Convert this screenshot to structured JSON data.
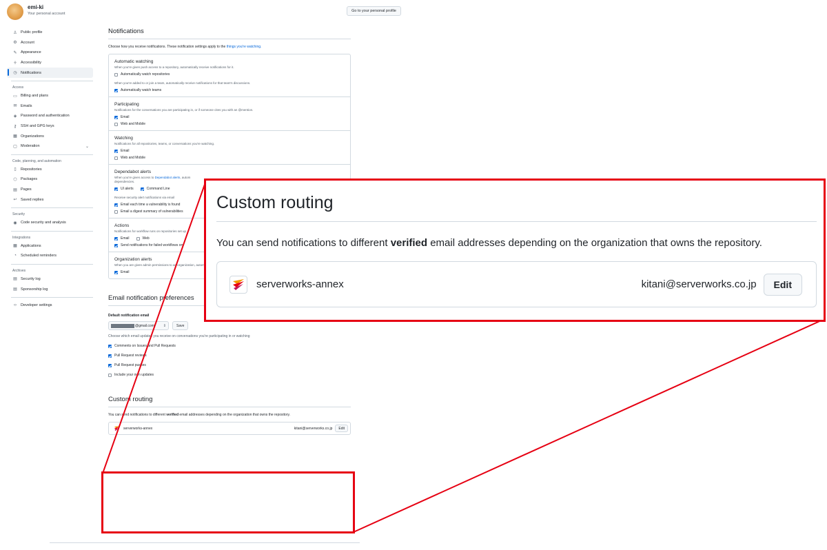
{
  "user": {
    "name": "emi-ki",
    "subtitle": "Your personal account",
    "profile_button": "Go to your personal profile"
  },
  "sidebar": {
    "items": [
      {
        "icon": "person-icon",
        "glyph": "♙",
        "label": "Public profile"
      },
      {
        "icon": "gear-icon",
        "glyph": "⚙",
        "label": "Account"
      },
      {
        "icon": "paintbrush-icon",
        "glyph": "✎",
        "label": "Appearance"
      },
      {
        "icon": "accessibility-icon",
        "glyph": "☥",
        "label": "Accessibility"
      },
      {
        "icon": "bell-icon",
        "glyph": "◷",
        "label": "Notifications",
        "active": true
      }
    ],
    "groups": [
      {
        "heading": "Access",
        "items": [
          {
            "icon": "credit-card-icon",
            "glyph": "▭",
            "label": "Billing and plans"
          },
          {
            "icon": "mail-icon",
            "glyph": "✉",
            "label": "Emails"
          },
          {
            "icon": "shield-lock-icon",
            "glyph": "◈",
            "label": "Password and authentication"
          },
          {
            "icon": "key-icon",
            "glyph": "⚷",
            "label": "SSH and GPG keys"
          },
          {
            "icon": "organization-icon",
            "glyph": "▦",
            "label": "Organizations"
          },
          {
            "icon": "report-icon",
            "glyph": "▢",
            "label": "Moderation",
            "chevron": "⌄"
          }
        ]
      },
      {
        "heading": "Code, planning, and automation",
        "items": [
          {
            "icon": "repo-icon",
            "glyph": "▯",
            "label": "Repositories"
          },
          {
            "icon": "package-icon",
            "glyph": "⬡",
            "label": "Packages"
          },
          {
            "icon": "browser-icon",
            "glyph": "▤",
            "label": "Pages"
          },
          {
            "icon": "reply-icon",
            "glyph": "↩",
            "label": "Saved replies"
          }
        ]
      },
      {
        "heading": "Security",
        "items": [
          {
            "icon": "shield-icon",
            "glyph": "◉",
            "label": "Code security and analysis"
          }
        ]
      },
      {
        "heading": "Integrations",
        "items": [
          {
            "icon": "apps-icon",
            "glyph": "▦",
            "label": "Applications"
          },
          {
            "icon": "clock-icon",
            "glyph": "◔",
            "label": "Scheduled reminders"
          }
        ]
      },
      {
        "heading": "Archives",
        "items": [
          {
            "icon": "log-icon",
            "glyph": "▤",
            "label": "Security log"
          },
          {
            "icon": "log-icon",
            "glyph": "▤",
            "label": "Sponsorship log"
          }
        ]
      }
    ],
    "developer": {
      "icon": "code-icon",
      "glyph": "‹›",
      "label": "Developer settings"
    }
  },
  "notifications": {
    "title": "Notifications",
    "intro_text": "Choose how you receive notifications. These notification settings apply to the ",
    "intro_link": "things you're watching.",
    "sections": {
      "auto": {
        "title": "Automatic watching",
        "desc1": "When you're given push access to a repository, automatically receive notifications for it.",
        "repos": {
          "label": "Automatically watch repositories",
          "checked": false
        },
        "desc2": "When you're added to or join a team, automatically receive notifications for that team's discussions.",
        "teams": {
          "label": "Automatically watch teams",
          "checked": true
        }
      },
      "participating": {
        "title": "Participating",
        "desc": "Notifications for the conversations you are participating in, or if someone cites you with an @mention.",
        "email": {
          "label": "Email",
          "checked": true
        },
        "web": {
          "label": "Web and Mobile",
          "checked": false
        }
      },
      "watching": {
        "title": "Watching",
        "desc": "Notifications for all repositories, teams, or conversations you're watching.",
        "email": {
          "label": "Email",
          "checked": true
        },
        "web": {
          "label": "Web and Mobile",
          "checked": false
        }
      },
      "dependabot": {
        "title": "Dependabot alerts",
        "desc_prefix": "When you're given access to ",
        "desc_link": "Dependabot alerts",
        "desc_suffix": ", autom",
        "desc_line2": "dependencies.",
        "ui": {
          "label": "UI alerts",
          "checked": true
        },
        "cli": {
          "label": "Command Line",
          "checked": true
        },
        "via": "Receive security alert notifications via email",
        "each": {
          "label": "Email each time a vulnerability is found",
          "checked": true
        },
        "digest": {
          "label": "Email a digest summary of vulnerabilities",
          "checked": false
        }
      },
      "actions": {
        "title": "Actions",
        "desc": "Notifications for workflow runs on repositories set up",
        "email": {
          "label": "Email",
          "checked": true
        },
        "web": {
          "label": "Web",
          "checked": false
        },
        "failed": {
          "label": "Send notifications for failed workflows on",
          "checked": true
        }
      },
      "org": {
        "title": "Organization alerts",
        "desc": "When you are given admin permissions to an organization, automatically receive notifications when a new deploy key is added.",
        "email": {
          "label": "Email",
          "checked": true
        }
      }
    }
  },
  "email_prefs": {
    "title": "Email notification preferences",
    "default_label": "Default notification email",
    "email_suffix": "@gmail.com",
    "select_arrow": "⇕",
    "save_label": "Save",
    "choose_desc": "Choose which email updates you receive on conversations you're participating in or watching",
    "options": [
      {
        "label": "Comments on Issues and Pull Requests",
        "checked": true
      },
      {
        "label": "Pull Request reviews",
        "checked": true
      },
      {
        "label": "Pull Request pushes",
        "checked": true
      },
      {
        "label": "Include your own updates",
        "checked": false
      }
    ]
  },
  "custom_routing": {
    "title": "Custom routing",
    "desc_prefix": "You can send notifications to different ",
    "desc_bold": "verified",
    "desc_suffix": " email addresses depending on the organization that owns the repository.",
    "org_name": "serverworks-annex",
    "email": "kitani@serverworks.co.jp",
    "edit_label": "Edit"
  },
  "colors": {
    "highlight": "#e60012",
    "link": "#0969da",
    "checkbox": "#0969da"
  }
}
